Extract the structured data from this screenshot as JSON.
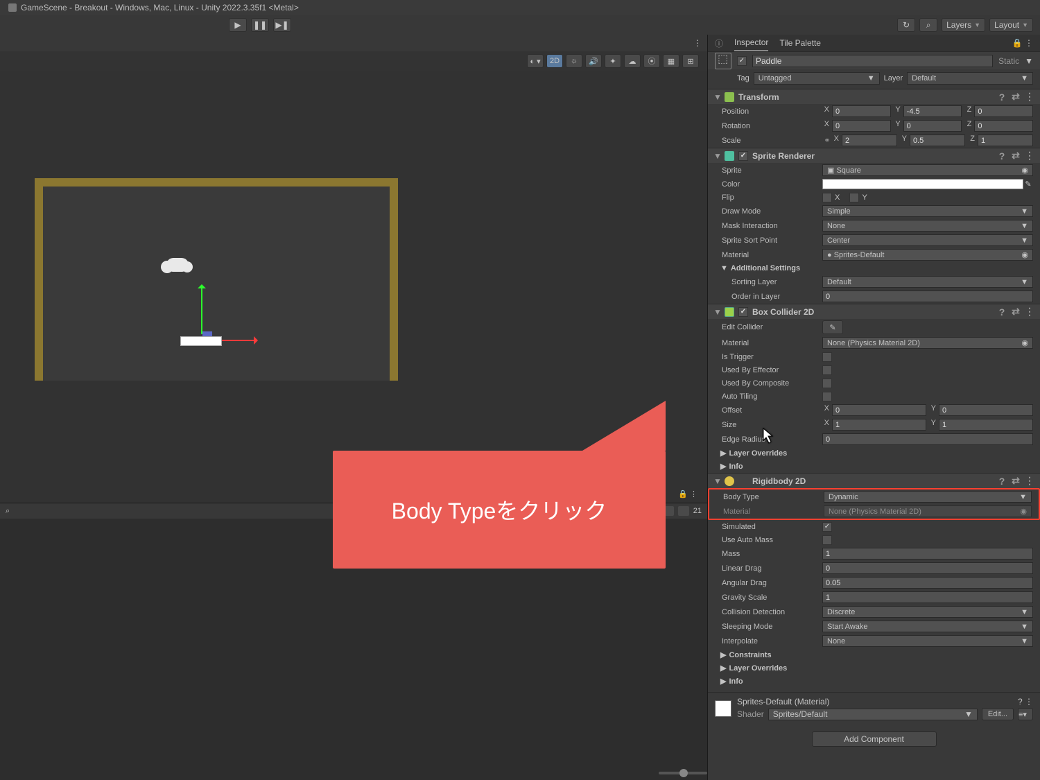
{
  "title": "GameScene - Breakout - Windows, Mac, Linux - Unity 2022.3.35f1 <Metal>",
  "topbar": {
    "layers": "Layers",
    "layout": "Layout"
  },
  "scene": {
    "mode2d": "2D",
    "counter": "21"
  },
  "tabs": {
    "inspector": "Inspector",
    "tilepalette": "Tile Palette"
  },
  "object": {
    "name": "Paddle",
    "static": "Static",
    "tag_lbl": "Tag",
    "tag": "Untagged",
    "layer_lbl": "Layer",
    "layer": "Default"
  },
  "transform": {
    "title": "Transform",
    "position_lbl": "Position",
    "pos": {
      "x": "0",
      "y": "-4.5",
      "z": "0"
    },
    "rotation_lbl": "Rotation",
    "rot": {
      "x": "0",
      "y": "0",
      "z": "0"
    },
    "scale_lbl": "Scale",
    "scale": {
      "x": "2",
      "y": "0.5",
      "z": "1"
    }
  },
  "sprite_renderer": {
    "title": "Sprite Renderer",
    "sprite_lbl": "Sprite",
    "sprite": "Square",
    "color_lbl": "Color",
    "flip_lbl": "Flip",
    "flip_x": "X",
    "flip_y": "Y",
    "drawmode_lbl": "Draw Mode",
    "drawmode": "Simple",
    "mask_lbl": "Mask Interaction",
    "mask": "None",
    "sort_lbl": "Sprite Sort Point",
    "sort": "Center",
    "material_lbl": "Material",
    "material": "Sprites-Default",
    "additional": "Additional Settings",
    "sorting_lbl": "Sorting Layer",
    "sorting": "Default",
    "order_lbl": "Order in Layer",
    "order": "0"
  },
  "box_collider": {
    "title": "Box Collider 2D",
    "edit_lbl": "Edit Collider",
    "material_lbl": "Material",
    "material": "None (Physics Material 2D)",
    "trigger_lbl": "Is Trigger",
    "effector_lbl": "Used By Effector",
    "composite_lbl": "Used By Composite",
    "autotiling_lbl": "Auto Tiling",
    "offset_lbl": "Offset",
    "offset": {
      "x": "0",
      "y": "0"
    },
    "size_lbl": "Size",
    "size": {
      "x": "1",
      "y": "1"
    },
    "edge_lbl": "Edge Radius",
    "edge": "0",
    "layerov": "Layer Overrides",
    "info": "Info"
  },
  "rigidbody": {
    "title": "Rigidbody 2D",
    "bodytype_lbl": "Body Type",
    "bodytype": "Dynamic",
    "material_lbl": "Material",
    "material": "None (Physics Material 2D)",
    "simulated_lbl": "Simulated",
    "automass_lbl": "Use Auto Mass",
    "mass_lbl": "Mass",
    "mass": "1",
    "lineardrag_lbl": "Linear Drag",
    "lineardrag": "0",
    "angulardrag_lbl": "Angular Drag",
    "angulardrag": "0.05",
    "gravity_lbl": "Gravity Scale",
    "gravity": "1",
    "collision_lbl": "Collision Detection",
    "collision": "Discrete",
    "sleeping_lbl": "Sleeping Mode",
    "sleeping": "Start Awake",
    "interpolate_lbl": "Interpolate",
    "interpolate": "None",
    "constraints": "Constraints",
    "layerov": "Layer Overrides",
    "info": "Info"
  },
  "material_section": {
    "name": "Sprites-Default (Material)",
    "shader_lbl": "Shader",
    "shader": "Sprites/Default",
    "edit": "Edit..."
  },
  "add_component": "Add Component",
  "callout": "Body Typeをクリック"
}
